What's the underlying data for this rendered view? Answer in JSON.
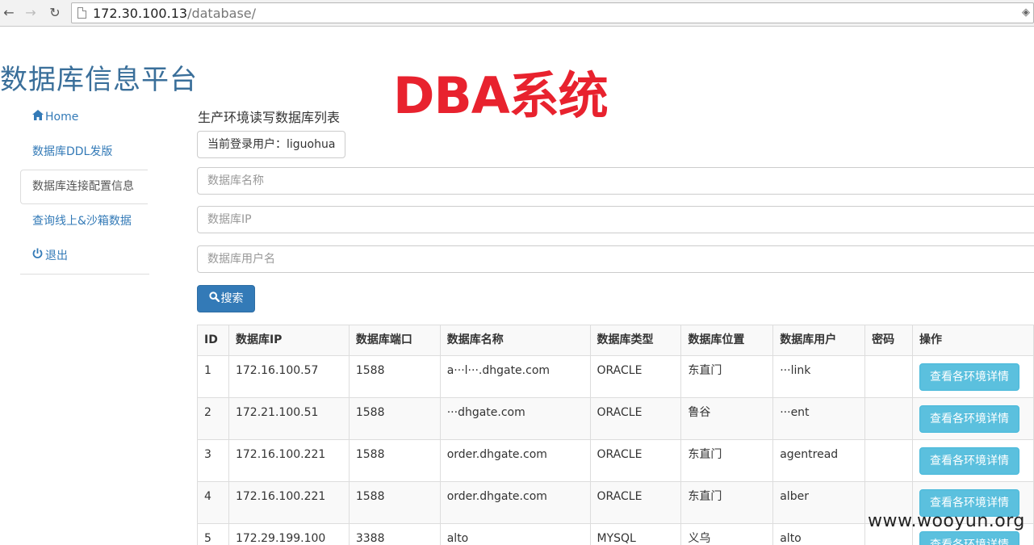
{
  "browser": {
    "url_host": "172.30.100.13",
    "url_path": "/database/"
  },
  "header": {
    "site_title": "数据库信息平台",
    "stamp": "DBA系统"
  },
  "sidebar": {
    "items": [
      {
        "label": "Home",
        "icon": "home-icon"
      },
      {
        "label": "数据库DDL发版"
      },
      {
        "label": "数据库连接配置信息",
        "active": true
      },
      {
        "label": "查询线上&沙箱数据"
      },
      {
        "label": "退出",
        "icon": "power-icon"
      }
    ]
  },
  "main": {
    "section_title": "生产环境读写数据库列表",
    "current_user": "当前登录用户：liguohua",
    "fields": {
      "db_name_placeholder": "数据库名称",
      "db_ip_placeholder": "数据库IP",
      "db_user_placeholder": "数据库用户名"
    },
    "search_label": "搜索"
  },
  "table": {
    "headers": [
      "ID",
      "数据库IP",
      "数据库端口",
      "数据库名称",
      "数据库类型",
      "数据库位置",
      "数据库用户",
      "密码",
      "操作"
    ],
    "action_label": "查看各环境详情",
    "rows": [
      {
        "id": "1",
        "ip": "172.16.100.57",
        "port": "1588",
        "name": "a···l···.dhgate.com",
        "type": "ORACLE",
        "location": "东直门",
        "user": "···link",
        "password": ""
      },
      {
        "id": "2",
        "ip": "172.21.100.51",
        "port": "1588",
        "name": "···dhgate.com",
        "type": "ORACLE",
        "location": "鲁谷",
        "user": "···ent",
        "password": ""
      },
      {
        "id": "3",
        "ip": "172.16.100.221",
        "port": "1588",
        "name": "order.dhgate.com",
        "type": "ORACLE",
        "location": "东直门",
        "user": "agentread",
        "password": ""
      },
      {
        "id": "4",
        "ip": "172.16.100.221",
        "port": "1588",
        "name": "order.dhgate.com",
        "type": "ORACLE",
        "location": "东直门",
        "user": "alber",
        "password": ""
      },
      {
        "id": "5",
        "ip": "172.29.199.100",
        "port": "3388",
        "name": "alto",
        "type": "MYSQL",
        "location": "义乌",
        "user": "alto",
        "password": ""
      }
    ]
  },
  "watermark": "www.wooyun.org"
}
